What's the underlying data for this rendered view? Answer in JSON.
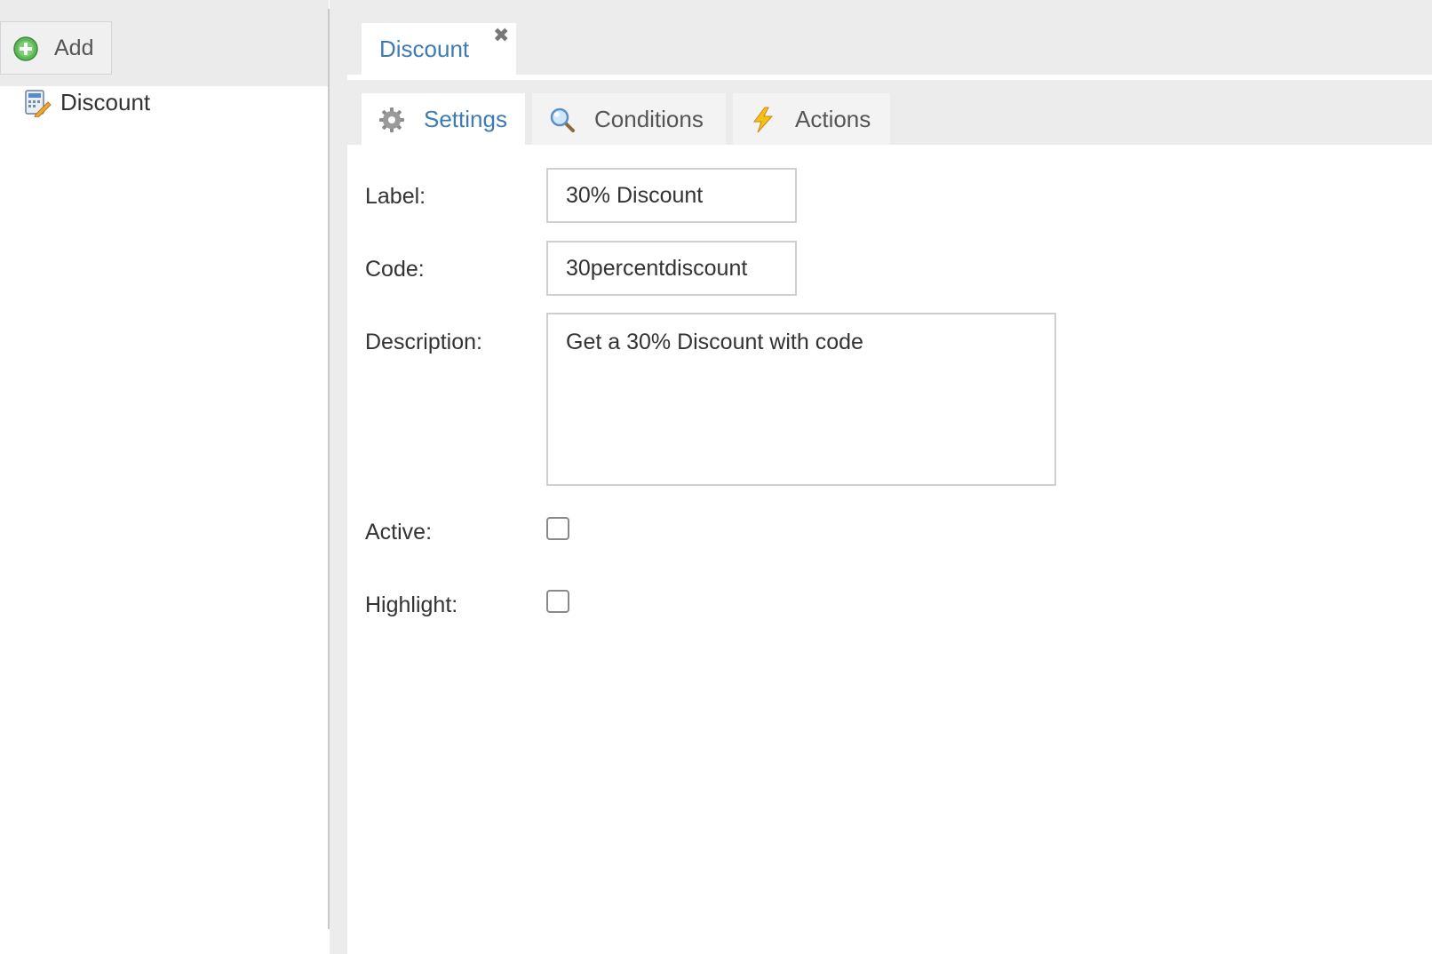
{
  "left_panel": {
    "add_label": "Add",
    "tree_items": [
      {
        "label": "Discount",
        "icon": "discount-calculator-icon"
      }
    ]
  },
  "document_tab": {
    "label": "Discount",
    "close_glyph": "✖"
  },
  "subtabs": [
    {
      "label": "Settings",
      "icon": "gear-icon",
      "active": true
    },
    {
      "label": "Conditions",
      "icon": "magnifier-icon",
      "active": false
    },
    {
      "label": "Actions",
      "icon": "lightning-icon",
      "active": false
    }
  ],
  "form": {
    "label_field": {
      "label": "Label:",
      "value": "30% Discount"
    },
    "code_field": {
      "label": "Code:",
      "value": "30percentdiscount"
    },
    "description_field": {
      "label": "Description:",
      "value": "Get a 30% Discount with code"
    },
    "active_field": {
      "label": "Active:",
      "checked": false
    },
    "highlight_field": {
      "label": "Highlight:",
      "checked": false
    }
  },
  "colors": {
    "accent_blue": "#3e7bb0",
    "panel_gray": "#ececec",
    "add_green": "#4caf50"
  }
}
